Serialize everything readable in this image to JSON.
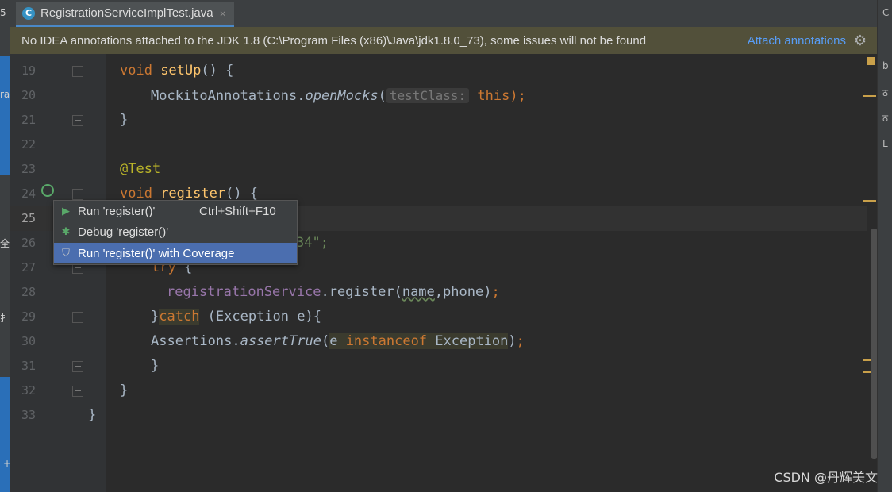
{
  "tab": {
    "filename": "RegistrationServiceImplTest.java",
    "file_icon": "C",
    "close": "×"
  },
  "banner": {
    "message": "No IDEA annotations attached to the JDK 1.8 (C:\\Program Files (x86)\\Java\\jdk1.8.0_73), some issues will not be found",
    "action": "Attach annotations"
  },
  "left_strip": [
    "5",
    "ra",
    "全",
    "扌",
    "+"
  ],
  "right_strip": [
    "C",
    "b",
    "ठ",
    "ठ",
    "L"
  ],
  "lines": {
    "l19": {
      "num": "19",
      "kw": "void ",
      "fn": "setUp",
      "rest": "() {"
    },
    "l20": {
      "num": "20",
      "cls": "MockitoAnnotations.",
      "method": "openMocks",
      "open": "(",
      "hint": "testClass:",
      "this": "this",
      "close": ");"
    },
    "l21": {
      "num": "21",
      "text": "}"
    },
    "l22": {
      "num": "22"
    },
    "l23": {
      "num": "23",
      "annotation": "@Test"
    },
    "l24": {
      "num": "24",
      "kw": "void ",
      "fn": "register",
      "rest": "() {"
    },
    "l25": {
      "num": "25",
      "tail": ";"
    },
    "l26": {
      "num": "26",
      "tail": "34\";"
    },
    "l27": {
      "num": "27",
      "kw": "try",
      "rest": " {"
    },
    "l28": {
      "num": "28",
      "field": "registrationService",
      "mid": ".register(",
      "arg1": "name",
      "sep": ",phone)",
      "semi": ";"
    },
    "l29": {
      "num": "29",
      "brace": "}",
      "kw": "catch",
      "rest": " (Exception e){"
    },
    "l30": {
      "num": "30",
      "cls": "Assertions.",
      "method": "assertTrue",
      "open": "(",
      "e": "e ",
      "kw": "instanceof",
      "typ": " Exception",
      "close": ")",
      "semi": ";"
    },
    "l31": {
      "num": "31",
      "text": "}"
    },
    "l32": {
      "num": "32",
      "text": "}"
    },
    "l33": {
      "num": "33",
      "text": "}"
    }
  },
  "popup": {
    "run_label": "Run 'register()'",
    "run_shortcut": "Ctrl+Shift+F10",
    "debug_label": "Debug 'register()'",
    "coverage_label": "Run 'register()' with Coverage"
  },
  "watermark": "CSDN @丹辉美文",
  "colors": {
    "accent": "#4b6eaf",
    "keyword": "#cc7832",
    "function": "#ffc66d",
    "annotation": "#bbb529",
    "field": "#9876aa"
  }
}
